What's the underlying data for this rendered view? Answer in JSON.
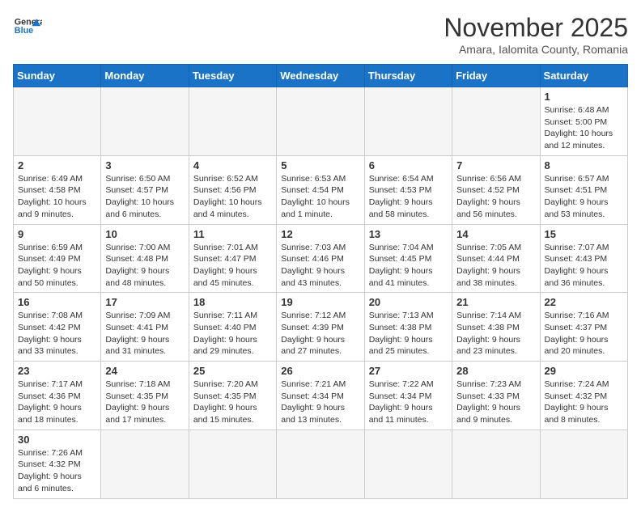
{
  "logo": {
    "text_general": "General",
    "text_blue": "Blue"
  },
  "title": "November 2025",
  "subtitle": "Amara, Ialomita County, Romania",
  "weekdays": [
    "Sunday",
    "Monday",
    "Tuesday",
    "Wednesday",
    "Thursday",
    "Friday",
    "Saturday"
  ],
  "weeks": [
    [
      {
        "day": "",
        "info": ""
      },
      {
        "day": "",
        "info": ""
      },
      {
        "day": "",
        "info": ""
      },
      {
        "day": "",
        "info": ""
      },
      {
        "day": "",
        "info": ""
      },
      {
        "day": "",
        "info": ""
      },
      {
        "day": "1",
        "info": "Sunrise: 6:48 AM\nSunset: 5:00 PM\nDaylight: 10 hours and 12 minutes."
      }
    ],
    [
      {
        "day": "2",
        "info": "Sunrise: 6:49 AM\nSunset: 4:58 PM\nDaylight: 10 hours and 9 minutes."
      },
      {
        "day": "3",
        "info": "Sunrise: 6:50 AM\nSunset: 4:57 PM\nDaylight: 10 hours and 6 minutes."
      },
      {
        "day": "4",
        "info": "Sunrise: 6:52 AM\nSunset: 4:56 PM\nDaylight: 10 hours and 4 minutes."
      },
      {
        "day": "5",
        "info": "Sunrise: 6:53 AM\nSunset: 4:54 PM\nDaylight: 10 hours and 1 minute."
      },
      {
        "day": "6",
        "info": "Sunrise: 6:54 AM\nSunset: 4:53 PM\nDaylight: 9 hours and 58 minutes."
      },
      {
        "day": "7",
        "info": "Sunrise: 6:56 AM\nSunset: 4:52 PM\nDaylight: 9 hours and 56 minutes."
      },
      {
        "day": "8",
        "info": "Sunrise: 6:57 AM\nSunset: 4:51 PM\nDaylight: 9 hours and 53 minutes."
      }
    ],
    [
      {
        "day": "9",
        "info": "Sunrise: 6:59 AM\nSunset: 4:49 PM\nDaylight: 9 hours and 50 minutes."
      },
      {
        "day": "10",
        "info": "Sunrise: 7:00 AM\nSunset: 4:48 PM\nDaylight: 9 hours and 48 minutes."
      },
      {
        "day": "11",
        "info": "Sunrise: 7:01 AM\nSunset: 4:47 PM\nDaylight: 9 hours and 45 minutes."
      },
      {
        "day": "12",
        "info": "Sunrise: 7:03 AM\nSunset: 4:46 PM\nDaylight: 9 hours and 43 minutes."
      },
      {
        "day": "13",
        "info": "Sunrise: 7:04 AM\nSunset: 4:45 PM\nDaylight: 9 hours and 41 minutes."
      },
      {
        "day": "14",
        "info": "Sunrise: 7:05 AM\nSunset: 4:44 PM\nDaylight: 9 hours and 38 minutes."
      },
      {
        "day": "15",
        "info": "Sunrise: 7:07 AM\nSunset: 4:43 PM\nDaylight: 9 hours and 36 minutes."
      }
    ],
    [
      {
        "day": "16",
        "info": "Sunrise: 7:08 AM\nSunset: 4:42 PM\nDaylight: 9 hours and 33 minutes."
      },
      {
        "day": "17",
        "info": "Sunrise: 7:09 AM\nSunset: 4:41 PM\nDaylight: 9 hours and 31 minutes."
      },
      {
        "day": "18",
        "info": "Sunrise: 7:11 AM\nSunset: 4:40 PM\nDaylight: 9 hours and 29 minutes."
      },
      {
        "day": "19",
        "info": "Sunrise: 7:12 AM\nSunset: 4:39 PM\nDaylight: 9 hours and 27 minutes."
      },
      {
        "day": "20",
        "info": "Sunrise: 7:13 AM\nSunset: 4:38 PM\nDaylight: 9 hours and 25 minutes."
      },
      {
        "day": "21",
        "info": "Sunrise: 7:14 AM\nSunset: 4:38 PM\nDaylight: 9 hours and 23 minutes."
      },
      {
        "day": "22",
        "info": "Sunrise: 7:16 AM\nSunset: 4:37 PM\nDaylight: 9 hours and 20 minutes."
      }
    ],
    [
      {
        "day": "23",
        "info": "Sunrise: 7:17 AM\nSunset: 4:36 PM\nDaylight: 9 hours and 18 minutes."
      },
      {
        "day": "24",
        "info": "Sunrise: 7:18 AM\nSunset: 4:35 PM\nDaylight: 9 hours and 17 minutes."
      },
      {
        "day": "25",
        "info": "Sunrise: 7:20 AM\nSunset: 4:35 PM\nDaylight: 9 hours and 15 minutes."
      },
      {
        "day": "26",
        "info": "Sunrise: 7:21 AM\nSunset: 4:34 PM\nDaylight: 9 hours and 13 minutes."
      },
      {
        "day": "27",
        "info": "Sunrise: 7:22 AM\nSunset: 4:34 PM\nDaylight: 9 hours and 11 minutes."
      },
      {
        "day": "28",
        "info": "Sunrise: 7:23 AM\nSunset: 4:33 PM\nDaylight: 9 hours and 9 minutes."
      },
      {
        "day": "29",
        "info": "Sunrise: 7:24 AM\nSunset: 4:32 PM\nDaylight: 9 hours and 8 minutes."
      }
    ],
    [
      {
        "day": "30",
        "info": "Sunrise: 7:26 AM\nSunset: 4:32 PM\nDaylight: 9 hours and 6 minutes."
      },
      {
        "day": "",
        "info": ""
      },
      {
        "day": "",
        "info": ""
      },
      {
        "day": "",
        "info": ""
      },
      {
        "day": "",
        "info": ""
      },
      {
        "day": "",
        "info": ""
      },
      {
        "day": "",
        "info": ""
      }
    ]
  ]
}
